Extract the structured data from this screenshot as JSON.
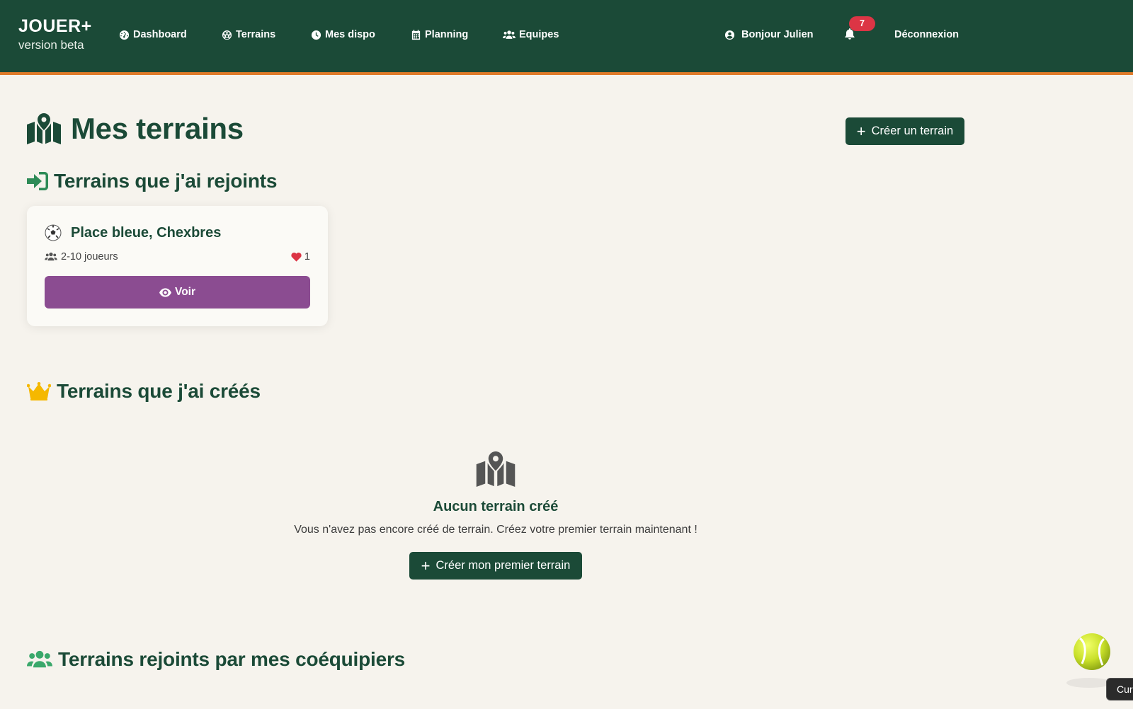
{
  "navbar": {
    "brand": "JOUER+",
    "brand_sub": "version beta",
    "items": [
      {
        "label": "Dashboard",
        "icon": "gauge-icon"
      },
      {
        "label": "Terrains",
        "icon": "soccer-ball-icon"
      },
      {
        "label": "Mes dispo",
        "icon": "clock-icon"
      },
      {
        "label": "Planning",
        "icon": "calendar-icon"
      },
      {
        "label": "Equipes",
        "icon": "users-icon"
      }
    ],
    "user_greeting": "Bonjour Julien",
    "notification_count": "7",
    "logout": "Déconnexion",
    "colors": {
      "bg": "#1b4a37",
      "accent": "#e07b2a",
      "badge": "#dc3545"
    }
  },
  "page": {
    "title": "Mes terrains",
    "create_button": "Créer un terrain"
  },
  "joined": {
    "title": "Terrains que j'ai rejoints",
    "cards": [
      {
        "name": "Place bleue, Chexbres",
        "players": "2-10 joueurs",
        "likes": "1",
        "view_button": "Voir"
      }
    ]
  },
  "created": {
    "title": "Terrains que j'ai créés",
    "empty_title": "Aucun terrain créé",
    "empty_text": "Vous n'avez pas encore créé de terrain. Créez votre premier terrain maintenant !",
    "empty_button": "Créer mon premier terrain"
  },
  "teammates": {
    "title": "Terrains rejoints par mes coéquipiers"
  },
  "tooltip": {
    "text": "Cur"
  },
  "colors": {
    "primary": "#1b4a37",
    "purple": "#8b4c91",
    "background": "#f6f3ed",
    "crown": "#f5b800"
  }
}
